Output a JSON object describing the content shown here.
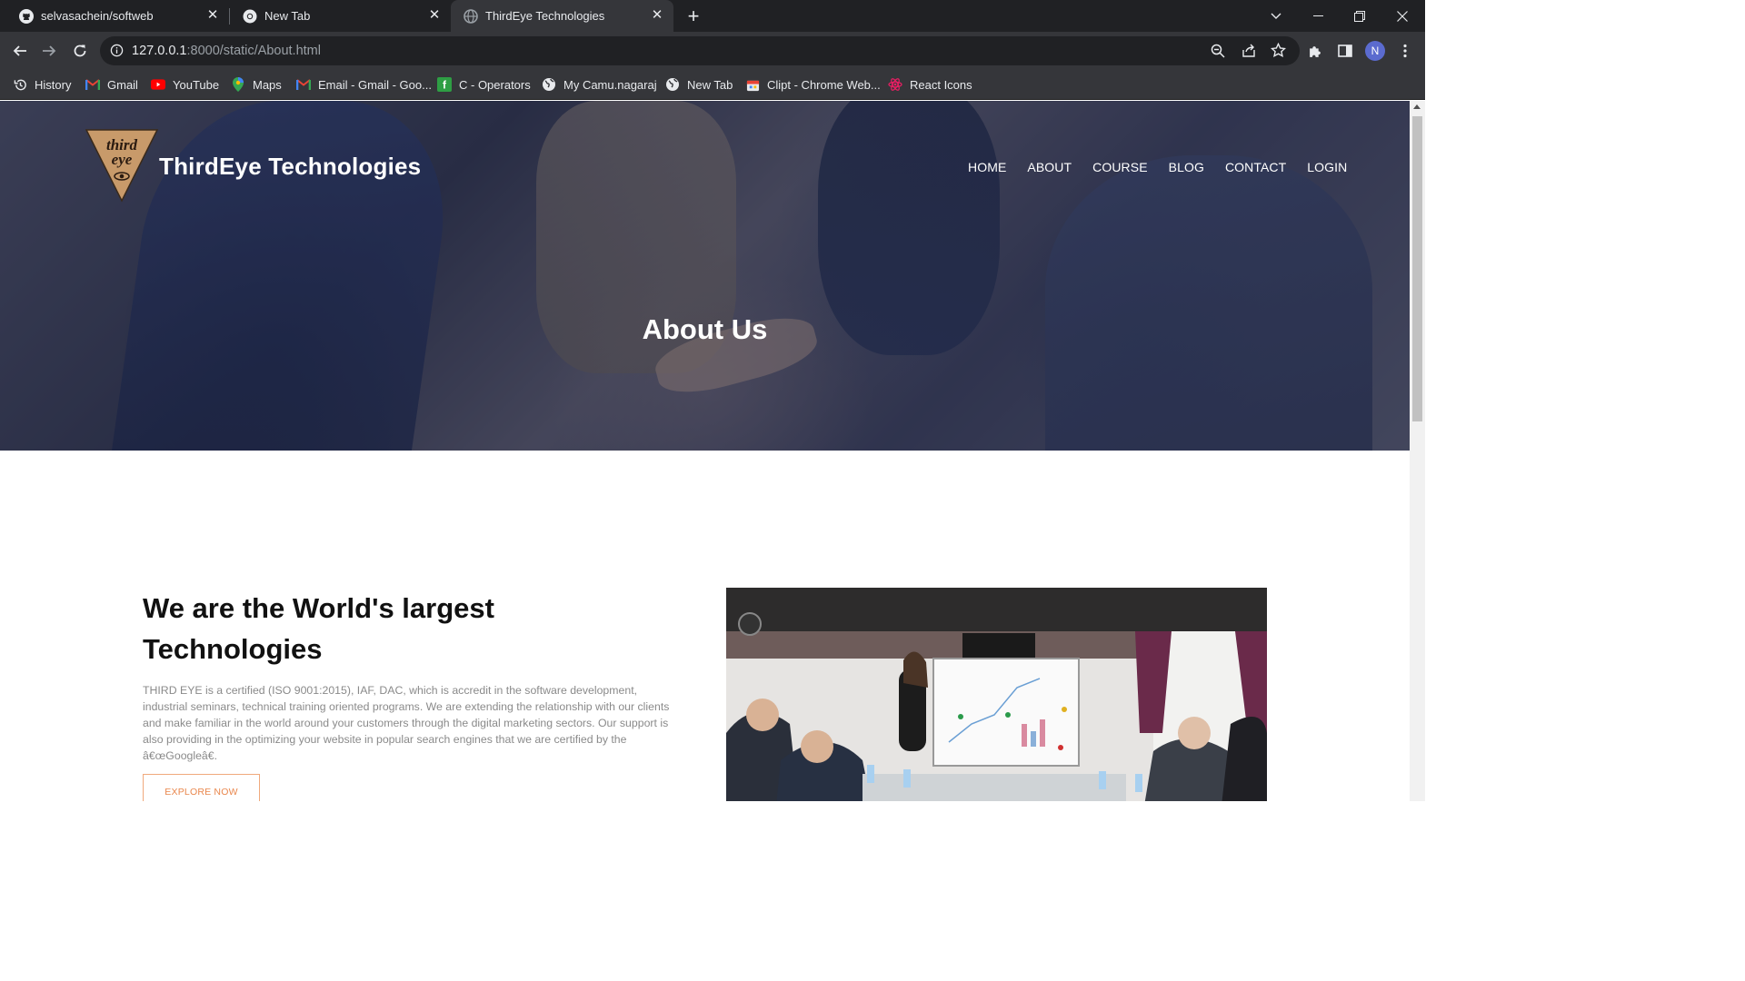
{
  "browser": {
    "tabs": [
      {
        "title": "selvasachein/softweb",
        "icon": "github-icon",
        "active": false
      },
      {
        "title": "New Tab",
        "icon": "chrome-icon",
        "active": false
      },
      {
        "title": "ThirdEye Technologies",
        "icon": "globe-icon",
        "active": true
      }
    ],
    "address": {
      "host": "127.0.0.1",
      "path": ":8000/static/About.html"
    },
    "profile_initial": "N",
    "bookmarks": [
      {
        "label": "History",
        "icon": "history-icon"
      },
      {
        "label": "Gmail",
        "icon": "gmail-icon"
      },
      {
        "label": "YouTube",
        "icon": "youtube-icon"
      },
      {
        "label": "Maps",
        "icon": "maps-icon"
      },
      {
        "label": "Email - Gmail - Goo...",
        "icon": "gmail-icon"
      },
      {
        "label": "C - Operators",
        "icon": "green-c-icon"
      },
      {
        "label": "My Camu.nagaraj",
        "icon": "globe-icon"
      },
      {
        "label": "New Tab",
        "icon": "globe-icon"
      },
      {
        "label": "Clipt - Chrome Web...",
        "icon": "clipt-icon"
      },
      {
        "label": "React Icons",
        "icon": "react-icons-icon"
      }
    ]
  },
  "site": {
    "logo_text_top": "third",
    "logo_text_bottom": "eye",
    "brand": "ThirdEye Technologies",
    "nav": [
      "HOME",
      "ABOUT",
      "COURSE",
      "BLOG",
      "CONTACT",
      "LOGIN"
    ],
    "hero_title": "About Us"
  },
  "about": {
    "heading": "We are the World's largest Technologies",
    "text": "THIRD EYE is a certified (ISO 9001:2015), IAF, DAC, which is accredit in the software development, industrial seminars, technical training oriented programs. We are extending the relationship with our clients and make familiar in the world around your customers through the digital marketing sectors. Our support is also providing in the optimizing your website in popular search engines that we are certified by the â€œGoogleâ€.",
    "button": "EXPLORE NOW"
  },
  "colors": {
    "accent": "#e9874d",
    "chrome_dark": "#202124",
    "chrome_tab": "#35363a"
  }
}
